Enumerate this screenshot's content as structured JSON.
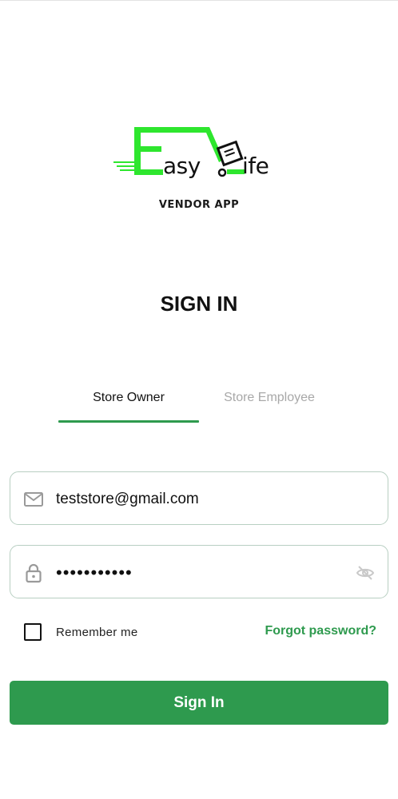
{
  "logo": {
    "word_left": "asy",
    "word_right": "ife",
    "tagline": "VENDOR APP",
    "brand_color": "#2ee62e"
  },
  "page_title": "SIGN IN",
  "tabs": [
    {
      "label": "Store Owner",
      "active": true
    },
    {
      "label": "Store Employee",
      "active": false
    }
  ],
  "form": {
    "email": {
      "value": "teststore@gmail.com",
      "icon": "mail-icon"
    },
    "password": {
      "value": "•••••••••••",
      "icon": "lock-icon",
      "toggle_icon": "eye-off-icon"
    },
    "remember_label": "Remember me",
    "remember_checked": false,
    "forgot_label": "Forgot password?",
    "submit_label": "Sign In"
  },
  "colors": {
    "accent": "#2e9a4e",
    "field_border": "#b8cfc2",
    "inactive_tab": "#a8a8a8"
  }
}
